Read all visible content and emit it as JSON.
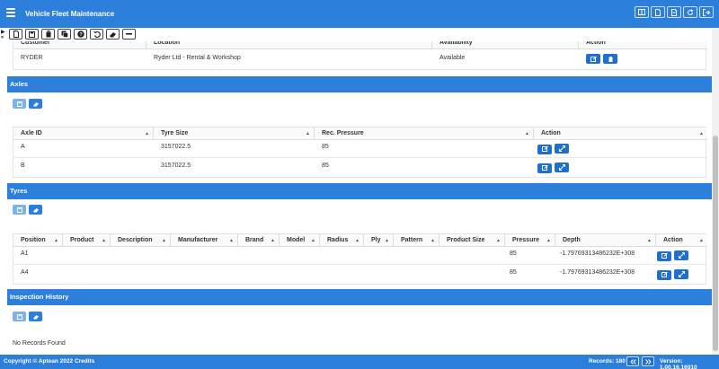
{
  "app": {
    "title": "Vehicle Fleet Maintenance"
  },
  "customer_grid": {
    "headers": [
      "Customer",
      "Location",
      "Availability",
      "Action"
    ],
    "rows": [
      {
        "customer": "RYDER",
        "location": "Ryder Ltd - Rental & Workshop",
        "availability": "Available"
      }
    ]
  },
  "axles": {
    "title": "Axles",
    "headers": [
      "Axle ID",
      "Tyre Size",
      "Rec. Pressure",
      "Action"
    ],
    "rows": [
      {
        "axle_id": "A",
        "tyre_size": "3157022.5",
        "rec_pressure": "85"
      },
      {
        "axle_id": "B",
        "tyre_size": "3157022.5",
        "rec_pressure": "85"
      }
    ]
  },
  "tyres": {
    "title": "Tyres",
    "headers": [
      "Position",
      "Product",
      "Description",
      "Manufacturer",
      "Brand",
      "Model",
      "Radius",
      "Ply",
      "Pattern",
      "Product Size",
      "Pressure",
      "Depth",
      "Action"
    ],
    "rows": [
      {
        "position": "A1",
        "pressure": "85",
        "depth": "-1.79769313486232E+308"
      },
      {
        "position": "A4",
        "pressure": "85",
        "depth": "-1.79769313486232E+308"
      }
    ]
  },
  "inspection": {
    "title": "Inspection History",
    "empty_text": "No Records Found"
  },
  "footer": {
    "copyright": "Copyright © Aptean 2022 Credits",
    "records": "Records: 180",
    "version": "Version: 1.00.16.16910"
  },
  "icons": {
    "title_buttons": [
      "layout-icon",
      "document-icon",
      "document-icon",
      "refresh-icon",
      "logout-icon"
    ],
    "toolbar": [
      "new-document-icon",
      "save-icon",
      "delete-icon",
      "copy-icon",
      "help-icon",
      "undo-icon",
      "eraser-icon",
      "minus-icon"
    ]
  },
  "colors": {
    "accent": "#2d7fdc",
    "dark_button": "#1f6fcf",
    "light_button": "#7db3ec"
  }
}
